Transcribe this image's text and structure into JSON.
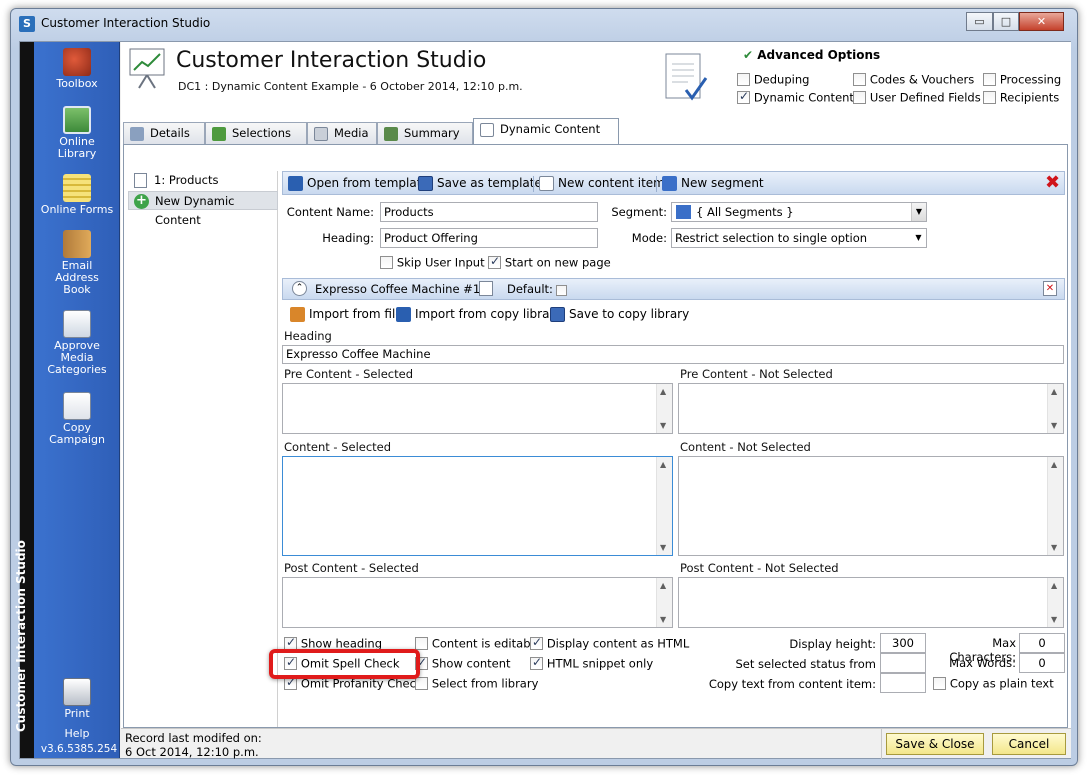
{
  "window": {
    "title": "Customer Interaction Studio",
    "minimize": "▭",
    "maximize": "□",
    "close": "✕"
  },
  "sidebar": {
    "vertical_title": "Customer Interaction Studio",
    "items": [
      {
        "label": "Toolbox",
        "icon": "toolbox-icon"
      },
      {
        "label": "Online Library",
        "icon": "online-library-icon"
      },
      {
        "label": "Online Forms",
        "icon": "online-forms-icon"
      },
      {
        "label": "Email Address Book",
        "icon": "address-book-icon"
      },
      {
        "label": "Approve Media Categories",
        "icon": "approve-media-icon"
      },
      {
        "label": "Copy Campaign",
        "icon": "copy-campaign-icon"
      },
      {
        "label": "Print",
        "icon": "printer-icon"
      },
      {
        "label": "Help",
        "icon": "help-icon"
      }
    ],
    "version": "v3.6.5385.254"
  },
  "header": {
    "title": "Customer Interaction Studio",
    "subtitle": "DC1 : Dynamic Content Example - 6 October 2014, 12:10 p.m."
  },
  "advanced_options": {
    "title": "Advanced Options",
    "options": [
      {
        "label": "Deduping",
        "checked": false
      },
      {
        "label": "Codes & Vouchers",
        "checked": false
      },
      {
        "label": "Processing",
        "checked": false
      },
      {
        "label": "Dynamic Content",
        "checked": true
      },
      {
        "label": "User Defined Fields",
        "checked": false
      },
      {
        "label": "Recipients",
        "checked": false
      }
    ]
  },
  "tabs": [
    {
      "label": "Details",
      "icon": "details-icon",
      "active": false
    },
    {
      "label": "Selections",
      "icon": "selections-icon",
      "active": false
    },
    {
      "label": "Media",
      "icon": "media-icon",
      "active": false
    },
    {
      "label": "Summary",
      "icon": "summary-icon",
      "active": false
    },
    {
      "label": "Dynamic Content",
      "icon": "dynamic-content-icon",
      "active": true
    }
  ],
  "tree": {
    "items": [
      {
        "label": "1: Products",
        "icon": "document-icon"
      },
      {
        "label": "New Dynamic Content",
        "icon": "add-icon"
      }
    ]
  },
  "toolbar": {
    "open_template": "Open from template",
    "save_template": "Save as template",
    "new_content_item": "New content item",
    "new_segment": "New segment"
  },
  "form": {
    "content_name_label": "Content Name:",
    "content_name_value": "Products",
    "heading_label": "Heading:",
    "heading_value": "Product Offering",
    "segment_label": "Segment:",
    "segment_value": "{ All Segments }",
    "mode_label": "Mode:",
    "mode_value": "Restrict selection to single option",
    "skip_user_input": "Skip User Input",
    "skip_user_input_checked": false,
    "start_new_page": "Start on new page",
    "start_new_page_checked": true
  },
  "content_item": {
    "title": "Expresso Coffee Machine #1",
    "default_label": "Default:",
    "default_checked": false,
    "import_file": "Import from file",
    "import_copy_library": "Import from copy library",
    "save_copy_library": "Save to copy library",
    "heading_label": "Heading",
    "heading_value": "Expresso Coffee Machine",
    "pre_selected": "Pre Content - Selected",
    "pre_not_selected": "Pre Content - Not Selected",
    "content_selected": "Content - Selected",
    "content_not_selected": "Content - Not Selected",
    "post_selected": "Post Content - Selected",
    "post_not_selected": "Post Content - Not Selected"
  },
  "options": {
    "show_heading": {
      "label": "Show heading",
      "checked": true
    },
    "omit_spell_check": {
      "label": "Omit Spell Check",
      "checked": true
    },
    "omit_profanity_check": {
      "label": "Omit Profanity Check",
      "checked": true
    },
    "content_is_editable": {
      "label": "Content is editable",
      "checked": false
    },
    "show_content": {
      "label": "Show content",
      "checked": true
    },
    "select_from_library": {
      "label": "Select from library",
      "checked": false
    },
    "display_as_html": {
      "label": "Display content as HTML",
      "checked": true
    },
    "html_snippet_only": {
      "label": "HTML snippet only",
      "checked": true
    },
    "display_height_label": "Display height:",
    "display_height_value": "300",
    "set_status_label": "Set selected status from",
    "copy_text_label": "Copy text from content item:",
    "max_characters_label": "Max Characters:",
    "max_characters_value": "0",
    "max_words_label": "Max Words:",
    "max_words_value": "0",
    "copy_plain_text": {
      "label": "Copy as plain text",
      "checked": false
    }
  },
  "status": {
    "record_label": "Record last modifed on:",
    "record_date": "6 Oct 2014, 12:10 p.m."
  },
  "buttons": {
    "save_close": "Save & Close",
    "cancel": "Cancel"
  },
  "colors": {
    "sidebar": "#3d75d2",
    "highlight": "#e01b1b",
    "button": "#f3e68a"
  }
}
